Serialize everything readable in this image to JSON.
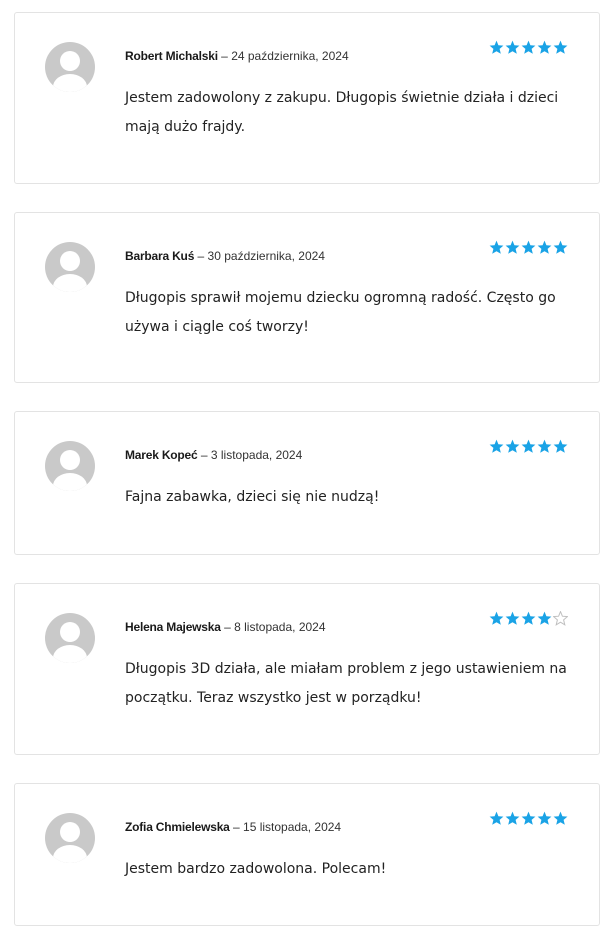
{
  "colors": {
    "star": "#1aa3e6",
    "star_empty": "#bfbfbf",
    "avatar": "#c9c9c9"
  },
  "reviews": [
    {
      "author": "Robert Michalski",
      "separator": "–",
      "date": "24 października, 2024",
      "rating": 5,
      "max_rating": 5,
      "text": "Jestem zadowolony z zakupu. Długopis świetnie działa i dzieci mają dużo frajdy."
    },
    {
      "author": "Barbara Kuś",
      "separator": "–",
      "date": "30 października, 2024",
      "rating": 5,
      "max_rating": 5,
      "text": "Długopis sprawił mojemu dziecku ogromną radość. Często go używa i ciągle coś tworzy!"
    },
    {
      "author": "Marek Kopeć",
      "separator": "–",
      "date": "3 listopada, 2024",
      "rating": 5,
      "max_rating": 5,
      "text": "Fajna zabawka, dzieci się nie nudzą!"
    },
    {
      "author": "Helena Majewska",
      "separator": "–",
      "date": "8 listopada, 2024",
      "rating": 4,
      "max_rating": 5,
      "text": "Długopis 3D działa, ale miałam problem z jego ustawieniem na początku. Teraz wszystko jest w porządku!"
    },
    {
      "author": "Zofia Chmielewska",
      "separator": "–",
      "date": "15 listopada, 2024",
      "rating": 5,
      "max_rating": 5,
      "text": "Jestem bardzo zadowolona. Polecam!"
    }
  ]
}
